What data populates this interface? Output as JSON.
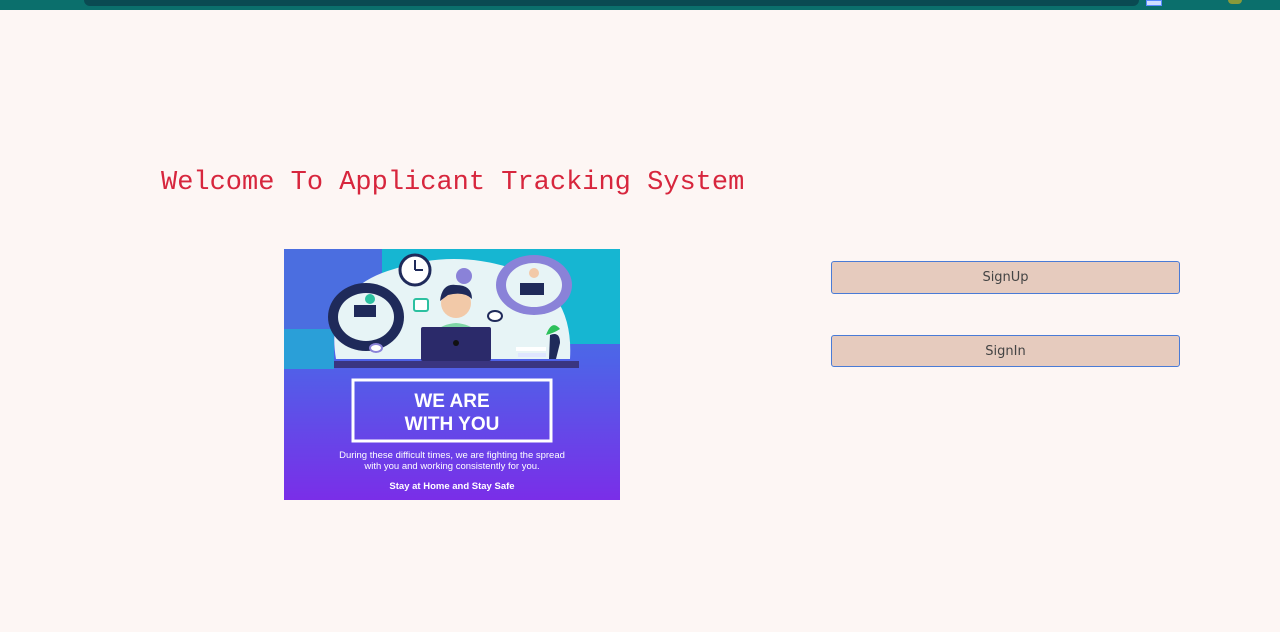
{
  "page": {
    "title": "Welcome To Applicant Tracking System"
  },
  "poster": {
    "headline_line1": "WE ARE",
    "headline_line2": "WITH YOU",
    "body_line1": "During these difficult times, we are fighting the spread",
    "body_line2": "with you and working consistently for you.",
    "tagline": "Stay at Home and Stay Safe"
  },
  "actions": {
    "signup_label": "SignUp",
    "signin_label": "SignIn"
  },
  "colors": {
    "background": "#fdf6f4",
    "title": "#d7263d",
    "button_bg": "#e6cbbe",
    "button_border": "#4a7bd6"
  }
}
